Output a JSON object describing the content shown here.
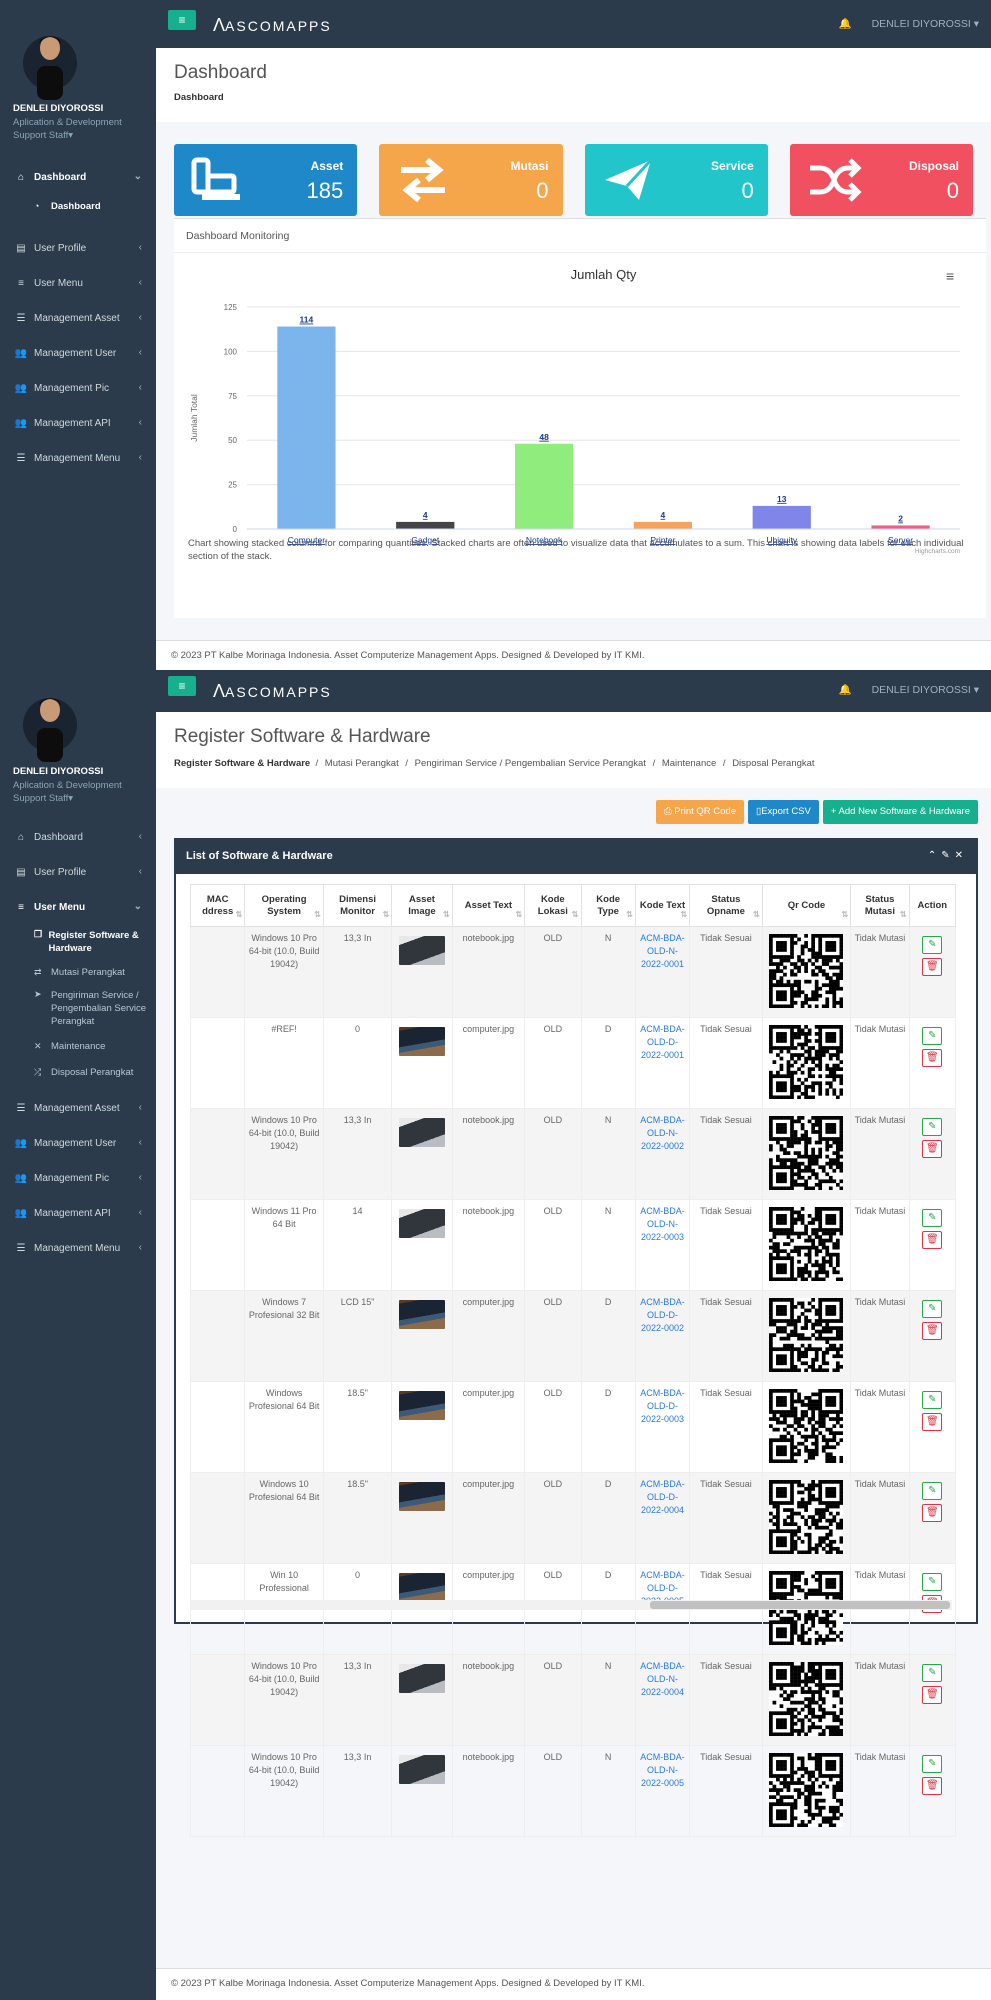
{
  "app": {
    "logo": "ASCOMAPPS"
  },
  "user": {
    "name": "DENLEI DIYOROSSI",
    "role": "Aplication & Development Support Staff",
    "caret": "▾"
  },
  "nav1": {
    "items": [
      {
        "label": "Dashboard",
        "icon": "home-icon"
      },
      {
        "label": "Dashboard",
        "icon": "dashboard-icon"
      },
      {
        "label": "User Profile",
        "icon": "id-card-icon"
      },
      {
        "label": "User Menu",
        "icon": "menu-icon"
      },
      {
        "label": "Management Asset",
        "icon": "sliders-icon"
      },
      {
        "label": "Management User",
        "icon": "users-icon"
      },
      {
        "label": "Management Pic",
        "icon": "users-icon"
      },
      {
        "label": "Management API",
        "icon": "users-icon"
      },
      {
        "label": "Management Menu",
        "icon": "sliders-icon"
      }
    ]
  },
  "page1": {
    "title": "Dashboard",
    "crumb": "Dashboard",
    "tiles": [
      {
        "label": "Asset",
        "value": "185",
        "color": "#1e88c9",
        "icon": "laptop-icon"
      },
      {
        "label": "Mutasi",
        "value": "0",
        "color": "#f5a54a",
        "icon": "exchange-icon"
      },
      {
        "label": "Service",
        "value": "0",
        "color": "#22c5c9",
        "icon": "paper-plane-icon"
      },
      {
        "label": "Disposal",
        "value": "0",
        "color": "#f0505f",
        "icon": "shuffle-icon"
      }
    ],
    "card_title": "Dashboard Monitoring",
    "menu_icon": "hamburger-icon",
    "credits": "Highcharts.com",
    "caption": "Chart showing stacked columns for comparing quantities. Stacked charts are often used to visualize data that accumulates to a sum. This chart is showing data labels for each individual section of the stack."
  },
  "chart_data": {
    "type": "bar",
    "title": "Jumlah Qty",
    "xlabel": "",
    "ylabel": "Jumlah Total",
    "categories": [
      "Computer",
      "Gadget",
      "Notebook",
      "Printer",
      "Ubiquity",
      "Server"
    ],
    "values": [
      114,
      4,
      48,
      4,
      13,
      2
    ],
    "colors": [
      "#7cb5ec",
      "#434348",
      "#90ed7d",
      "#f7a35c",
      "#8085e9",
      "#f15c80"
    ],
    "yticks": [
      0,
      25,
      50,
      75,
      100,
      125
    ],
    "ylim": [
      0,
      125
    ],
    "grid": true,
    "legend": "none"
  },
  "footer": "© 2023 PT Kalbe Morinaga Indonesia. Asset Computerize Management Apps. Designed & Developed by IT KMI.",
  "footer2": "© 2023 PT Kalbe Morinaga Indonesia. Asset Computerize Management Apps. Designed & Developed by IT KMI.",
  "nav2": {
    "items": [
      {
        "label": "Dashboard"
      },
      {
        "label": "User Profile"
      },
      {
        "label": "User Menu"
      },
      {
        "label": "Management Asset"
      },
      {
        "label": "Management User"
      },
      {
        "label": "Management Pic"
      },
      {
        "label": "Management API"
      },
      {
        "label": "Management Menu"
      }
    ],
    "sub": [
      {
        "label": "Register Software & Hardware",
        "icon": "clone-icon"
      },
      {
        "label": "Mutasi Perangkat",
        "icon": "exchange-icon"
      },
      {
        "label": "Pengiriman Service / Pengembalian Service Perangkat",
        "icon": "paper-plane-icon"
      },
      {
        "label": "Maintenance",
        "icon": "wrench-icon"
      },
      {
        "label": "Disposal Perangkat",
        "icon": "shuffle-icon"
      }
    ]
  },
  "page2": {
    "title": "Register Software & Hardware",
    "crumbs": [
      "Register Software & Hardware",
      "Mutasi Perangkat",
      "Pengiriman Service / Pengembalian Service Perangkat",
      "Maintenance",
      "Disposal Perangkat"
    ],
    "buttons": {
      "print": "Print QR Code",
      "csv": "Export CSV",
      "add": "+ Add New Software & Hardware"
    },
    "box_title": "List of Software & Hardware",
    "columns": [
      "MAC ddress",
      "Operating System",
      "Dimensi Monitor",
      "Asset Image",
      "Asset Text",
      "Kode Lokasi",
      "Kode Type",
      "Kode Text",
      "Status Opname",
      "Qr Code",
      "Status Mutasi",
      "Action"
    ],
    "rows": [
      {
        "mac": "",
        "os": "Windows 10 Pro 64-bit (10.0, Build 19042)",
        "dim": "13,3 In",
        "img": "nb",
        "text": "notebook.jpg",
        "lok": "OLD",
        "type": "N",
        "kode": "ACM-BDA-OLD-N-2022-0001",
        "opname": "Tidak Sesuai",
        "mutasi": "Tidak Mutasi"
      },
      {
        "mac": "",
        "os": "#REF!",
        "dim": "0",
        "img": "pc",
        "text": "computer.jpg",
        "lok": "OLD",
        "type": "D",
        "kode": "ACM-BDA-OLD-D-2022-0001",
        "opname": "Tidak Sesuai",
        "mutasi": "Tidak Mutasi"
      },
      {
        "mac": "",
        "os": "Windows 10 Pro 64-bit (10.0, Build 19042)",
        "dim": "13,3 In",
        "img": "nb",
        "text": "notebook.jpg",
        "lok": "OLD",
        "type": "N",
        "kode": "ACM-BDA-OLD-N-2022-0002",
        "opname": "Tidak Sesuai",
        "mutasi": "Tidak Mutasi"
      },
      {
        "mac": "",
        "os": "Windows 11 Pro 64 Bit",
        "dim": "14",
        "img": "nb",
        "text": "notebook.jpg",
        "lok": "OLD",
        "type": "N",
        "kode": "ACM-BDA-OLD-N-2022-0003",
        "opname": "Tidak Sesuai",
        "mutasi": "Tidak Mutasi"
      },
      {
        "mac": "",
        "os": "Windows 7 Profesional 32 Bit",
        "dim": "LCD 15\"",
        "img": "pc",
        "text": "computer.jpg",
        "lok": "OLD",
        "type": "D",
        "kode": "ACM-BDA-OLD-D-2022-0002",
        "opname": "Tidak Sesuai",
        "mutasi": "Tidak Mutasi"
      },
      {
        "mac": "",
        "os": "Windows Profesional 64 Bit",
        "dim": "18.5\"",
        "img": "pc",
        "text": "computer.jpg",
        "lok": "OLD",
        "type": "D",
        "kode": "ACM-BDA-OLD-D-2022-0003",
        "opname": "Tidak Sesuai",
        "mutasi": "Tidak Mutasi"
      },
      {
        "mac": "",
        "os": "Windows 10 Profesional 64 Bit",
        "dim": "18.5\"",
        "img": "pc",
        "text": "computer.jpg",
        "lok": "OLD",
        "type": "D",
        "kode": "ACM-BDA-OLD-D-2022-0004",
        "opname": "Tidak Sesuai",
        "mutasi": "Tidak Mutasi"
      },
      {
        "mac": "",
        "os": "Win 10 Professional",
        "dim": "0",
        "img": "pc",
        "text": "computer.jpg",
        "lok": "OLD",
        "type": "D",
        "kode": "ACM-BDA-OLD-D-2022-0005",
        "opname": "Tidak Sesuai",
        "mutasi": "Tidak Mutasi"
      },
      {
        "mac": "",
        "os": "Windows 10 Pro 64-bit (10.0, Build 19042)",
        "dim": "13,3 In",
        "img": "nb",
        "text": "notebook.jpg",
        "lok": "OLD",
        "type": "N",
        "kode": "ACM-BDA-OLD-N-2022-0004",
        "opname": "Tidak Sesuai",
        "mutasi": "Tidak Mutasi"
      },
      {
        "mac": "",
        "os": "Windows 10 Pro 64-bit (10.0, Build 19042)",
        "dim": "13,3 In",
        "img": "nb",
        "text": "notebook.jpg",
        "lok": "OLD",
        "type": "N",
        "kode": "ACM-BDA-OLD-N-2022-0005",
        "opname": "Tidak Sesuai",
        "mutasi": "Tidak Mutasi"
      }
    ]
  }
}
